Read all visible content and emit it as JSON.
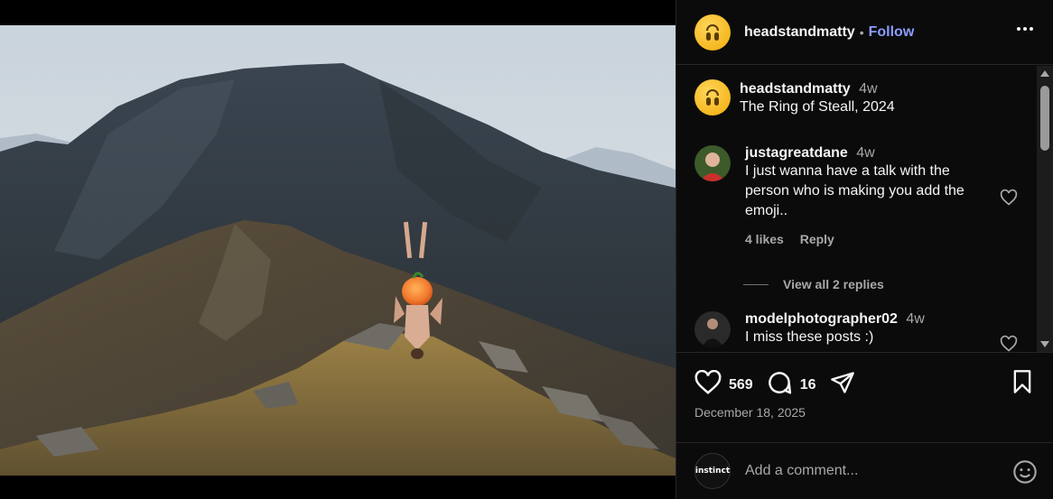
{
  "post": {
    "author": "headstandmatty",
    "follow_label": "Follow",
    "separator": "•",
    "more_label": "•••"
  },
  "caption": {
    "author": "headstandmatty",
    "time": "4w",
    "text": "The Ring of Steall, 2024"
  },
  "comments": [
    {
      "author": "justagreatdane",
      "time": "4w",
      "text": "I just wanna have a talk with the person who is making you add the emoji..",
      "likes": "4 likes",
      "reply_label": "Reply",
      "view_replies": "View all 2 replies"
    },
    {
      "author": "modelphotographer02",
      "time": "4w",
      "text": "I miss these posts :)"
    }
  ],
  "actions": {
    "like_count": "569",
    "comment_count": "16",
    "date": "December 18, 2025"
  },
  "add_comment": {
    "placeholder": "Add a comment...",
    "avatar_text": "instinct"
  },
  "icons": {
    "like": "heart-icon",
    "comment": "comment-bubble-icon",
    "share": "paper-plane-icon",
    "save": "bookmark-icon",
    "emoji": "smiley-icon",
    "more": "more-horizontal-icon"
  },
  "colors": {
    "background": "#0b0b0c",
    "follow": "#8b9cff",
    "muted": "#a8a8a8"
  }
}
